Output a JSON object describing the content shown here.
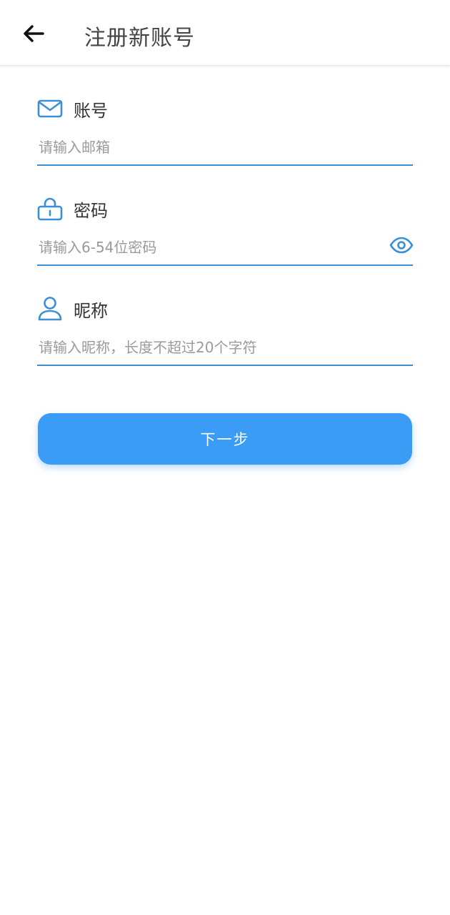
{
  "header": {
    "title": "注册新账号",
    "back_icon": "arrow-left-icon"
  },
  "form": {
    "account": {
      "label": "账号",
      "placeholder": "请输入邮箱",
      "icon": "mail-icon",
      "value": ""
    },
    "password": {
      "label": "密码",
      "placeholder": "请输入6-54位密码",
      "icon": "lock-icon",
      "toggle_icon": "eye-icon",
      "value": ""
    },
    "nickname": {
      "label": "昵称",
      "placeholder": "请输入昵称，长度不超过20个字符",
      "icon": "user-icon",
      "value": ""
    }
  },
  "actions": {
    "next_label": "下一步"
  },
  "colors": {
    "accent": "#3a8fd6",
    "button": "#3b9cf5",
    "title": "#444444",
    "placeholder": "#9a9a9a"
  }
}
